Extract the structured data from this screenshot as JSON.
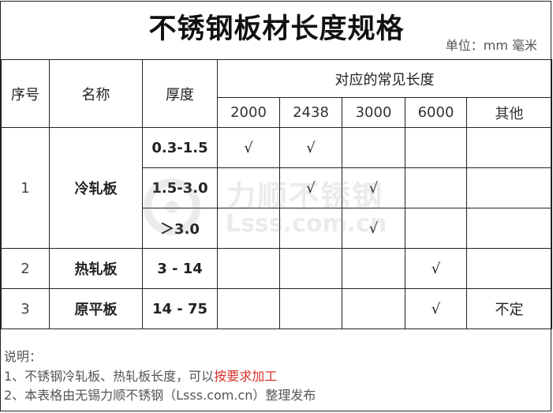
{
  "title": "不锈钢板材长度规格",
  "unit": "单位：mm 毫米",
  "header": {
    "index": "序号",
    "name": "名称",
    "thickness": "厚度",
    "lengths_group": "对应的常见长度",
    "lengths": [
      "2000",
      "2438",
      "3000",
      "6000",
      "其他"
    ]
  },
  "rows": [
    {
      "index": "1",
      "name": "冷轧板",
      "subrows": [
        {
          "thickness": "0.3-1.5",
          "cells": [
            "√",
            "√",
            "",
            "",
            ""
          ]
        },
        {
          "thickness": "1.5-3.0",
          "cells": [
            "",
            "√",
            "√",
            "",
            ""
          ]
        },
        {
          "thickness": "＞3.0",
          "cells": [
            "",
            "",
            "√",
            "",
            ""
          ]
        }
      ]
    },
    {
      "index": "2",
      "name": "热轧板",
      "thickness": "3 - 14",
      "cells": [
        "",
        "",
        "",
        "√",
        ""
      ]
    },
    {
      "index": "3",
      "name": "原平板",
      "thickness": "14 - 75",
      "cells": [
        "",
        "",
        "",
        "√",
        "不定"
      ]
    }
  ],
  "notes": {
    "heading": "说明：",
    "line1_prefix": "1、不锈钢冷轧板、热轧板长度，可以",
    "line1_highlight": "按要求加工",
    "line2": "2、本表格由无锡力顺不锈钢（Lsss.com.cn）整理发布"
  },
  "watermark": {
    "cn": "力顺不锈钢",
    "en": "Lsss.com.cn"
  },
  "colors": {
    "highlight": "#d6332c",
    "border": "#222222"
  }
}
